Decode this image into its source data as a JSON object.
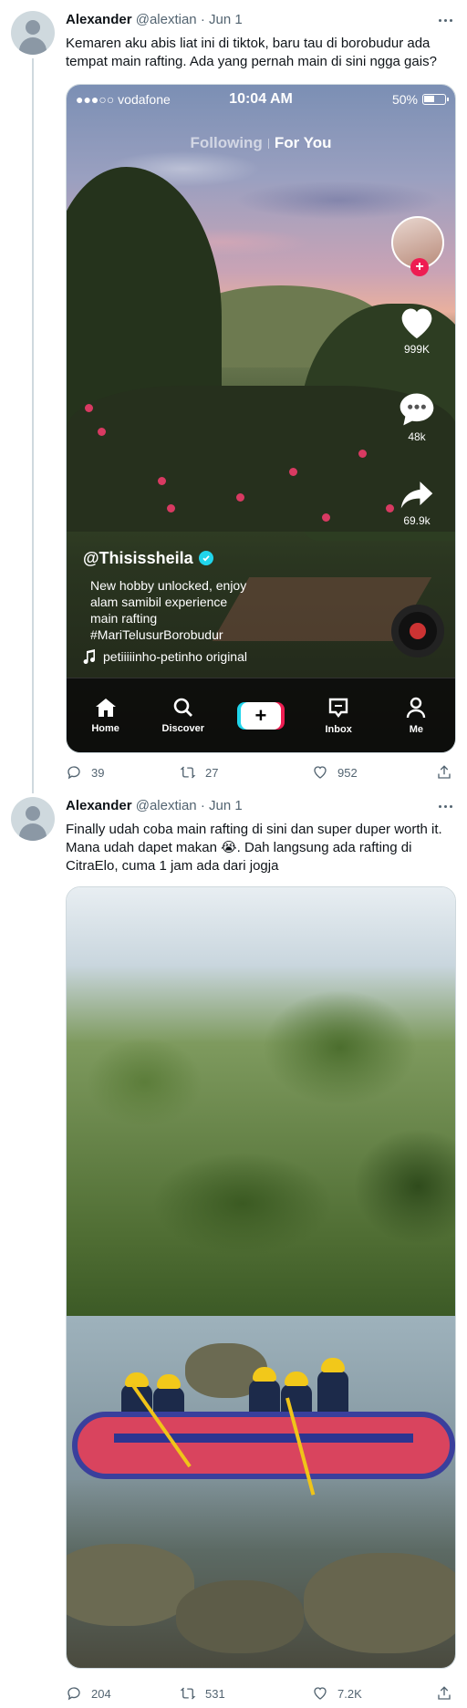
{
  "tweets": [
    {
      "name": "Alexander",
      "handle": "@alextian",
      "dot": "·",
      "date": "Jun 1",
      "text": "Kemaren aku abis liat ini di tiktok, baru tau di borobudur ada tempat main rafting. Ada yang pernah main di sini ngga gais?",
      "stats": {
        "replies": "39",
        "retweets": "27",
        "likes": "952"
      }
    },
    {
      "name": "Alexander",
      "handle": "@alextian",
      "dot": "·",
      "date": "Jun 1",
      "text": "Finally udah coba main rafting di sini dan super duper worth it. Mana udah dapet makan 😭. Dah langsung ada rafting di CitraElo, cuma 1 jam ada dari jogja",
      "stats": {
        "replies": "204",
        "retweets": "531",
        "likes": "7.2K"
      }
    }
  ],
  "tiktok": {
    "status": {
      "carrier": "●●●○○ vodafone",
      "time": "10:04 AM",
      "battery": "50%"
    },
    "tabs": {
      "following": "Following",
      "for_you": "For You"
    },
    "likes": "999K",
    "comments": "48k",
    "shares": "69.9k",
    "username": "@Thisissheila",
    "description": "New hobby unlocked, enjoy\nalam samibil experience\nmain rafting\n#MariTelusurBorobudur",
    "sound": "petiiiiinho-petinho original",
    "nav": {
      "home": "Home",
      "discover": "Discover",
      "inbox": "Inbox",
      "me": "Me"
    }
  },
  "colors": {
    "accent_red": "#ee1d52",
    "accent_cyan": "#20d5ec",
    "muted": "#536471"
  }
}
